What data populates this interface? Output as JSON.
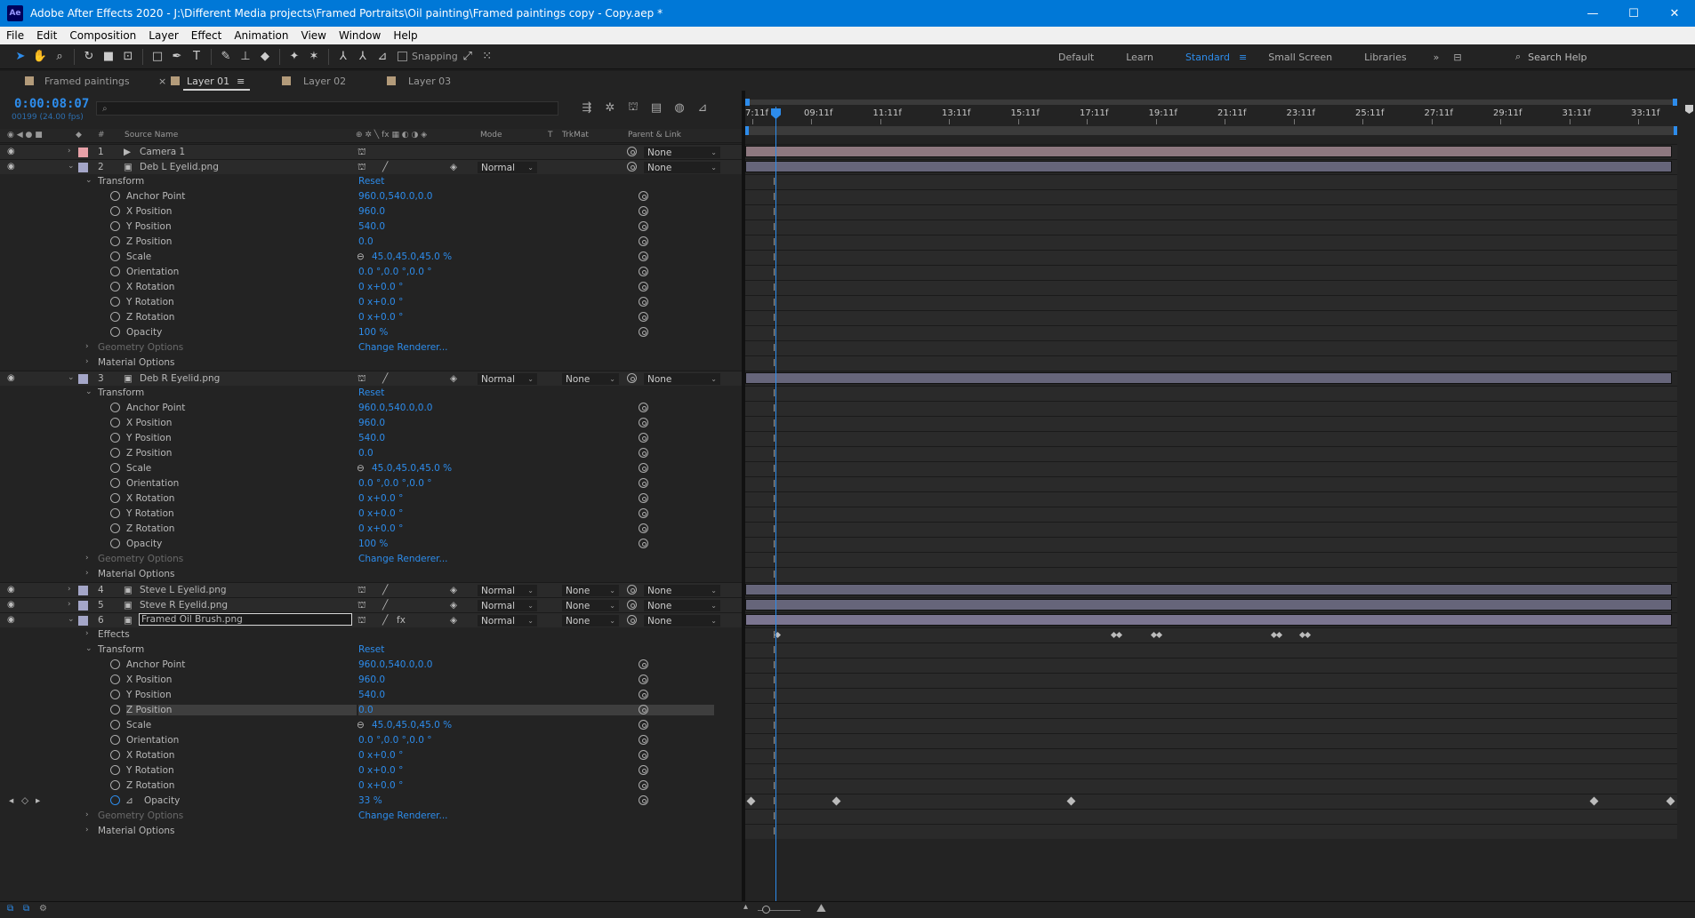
{
  "window": {
    "app_logo": "Ae",
    "title": "Adobe After Effects 2020 - J:\\Different Media projects\\Framed Portraits\\Oil painting\\Framed paintings copy - Copy.aep *",
    "minimize": "—",
    "maximize": "☐",
    "close": "✕"
  },
  "menu": [
    "File",
    "Edit",
    "Composition",
    "Layer",
    "Effect",
    "Animation",
    "View",
    "Window",
    "Help"
  ],
  "toolbar": {
    "snapping_label": "Snapping",
    "workspaces": [
      "Default",
      "Learn",
      "Standard",
      "Small Screen",
      "Libraries"
    ],
    "active_workspace": "Standard",
    "search_help_placeholder": "Search Help"
  },
  "tabs": [
    {
      "label": "Framed paintings",
      "active": false
    },
    {
      "label": "Layer 01",
      "active": true
    },
    {
      "label": "Layer 02",
      "active": false
    },
    {
      "label": "Layer 03",
      "active": false
    }
  ],
  "timeline": {
    "timecode": "0:00:08:07",
    "frame_info": "00199 (24.00 fps)",
    "search_placeholder": "⌕",
    "columns": {
      "num": "#",
      "source_name": "Source Name",
      "mode": "Mode",
      "t": "T",
      "trkmat": "TrkMat",
      "parent": "Parent & Link"
    },
    "ruler_labels": [
      "7:11f",
      "09:11f",
      "11:11f",
      "13:11f",
      "15:11f",
      "17:11f",
      "19:11f",
      "21:11f",
      "23:11f",
      "25:11f",
      "27:11f",
      "29:11f",
      "31:11f",
      "33:11f"
    ],
    "ruler_note": ":11f"
  },
  "layers": [
    {
      "num": "1",
      "name": "Camera 1",
      "mode": "",
      "trkmat": "",
      "parent": "None",
      "label_color": "#e8a1a8",
      "bar_color": "#8e7880"
    },
    {
      "num": "2",
      "name": "Deb L Eyelid.png",
      "mode": "Normal",
      "trkmat": "",
      "parent": "None",
      "label_color": "#a4a6c8",
      "bar_color": "#66657a"
    },
    {
      "num": "3",
      "name": "Deb R Eyelid.png",
      "mode": "Normal",
      "trkmat": "None",
      "parent": "None",
      "label_color": "#a4a6c8",
      "bar_color": "#66657a"
    },
    {
      "num": "4",
      "name": "Steve L Eyelid.png",
      "mode": "Normal",
      "trkmat": "None",
      "parent": "None",
      "label_color": "#a4a6c8",
      "bar_color": "#66657a"
    },
    {
      "num": "5",
      "name": "Steve R Eyelid.png",
      "mode": "Normal",
      "trkmat": "None",
      "parent": "None",
      "label_color": "#a4a6c8",
      "bar_color": "#66657a"
    },
    {
      "num": "6",
      "name": "Framed Oil Brush.png",
      "mode": "Normal",
      "trkmat": "None",
      "parent": "None",
      "label_color": "#a4a6c8",
      "bar_color": "#7b7590"
    }
  ],
  "props": {
    "transform": "Transform",
    "reset": "Reset",
    "anchor_point": "Anchor Point",
    "x_position": "X Position",
    "y_position": "Y Position",
    "z_position": "Z Position",
    "scale": "Scale",
    "orientation": "Orientation",
    "x_rotation": "X Rotation",
    "y_rotation": "Y Rotation",
    "z_rotation": "Z Rotation",
    "opacity": "Opacity",
    "geometry_options": "Geometry Options",
    "change_renderer": "Change Renderer...",
    "material_options": "Material Options",
    "effects": "Effects"
  },
  "values": {
    "anchor_point": "960.0,540.0,0.0",
    "x_position": "960.0",
    "y_position": "540.0",
    "z_position": "0.0",
    "scale": "45.0,45.0,45.0 %",
    "orientation": "0.0 °,0.0 °,0.0 °",
    "rotation": "0 x+0.0 °",
    "opacity_full": "100 %",
    "opacity_layer6": "33 %"
  },
  "colors": {
    "accent": "#2d8ceb",
    "titlebar": "#0078d7"
  }
}
